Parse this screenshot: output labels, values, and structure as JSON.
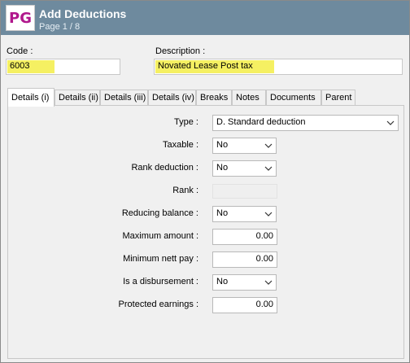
{
  "header": {
    "logo": "PG",
    "title": "Add Deductions",
    "page": "Page 1 / 8"
  },
  "code": {
    "label": "Code :",
    "value": "6003"
  },
  "description": {
    "label": "Description :",
    "value": "Novated Lease Post tax"
  },
  "tabs": [
    {
      "label": "Details (i)"
    },
    {
      "label": "Details (ii)"
    },
    {
      "label": "Details (iii)"
    },
    {
      "label": "Details (iv)"
    },
    {
      "label": "Breaks"
    },
    {
      "label": "Notes"
    },
    {
      "label": "Documents"
    },
    {
      "label": "Parent"
    }
  ],
  "details": {
    "type": {
      "label": "Type :",
      "value": "D. Standard deduction"
    },
    "taxable": {
      "label": "Taxable :",
      "value": "No"
    },
    "rank_deduction": {
      "label": "Rank deduction :",
      "value": "No"
    },
    "rank": {
      "label": "Rank :"
    },
    "reducing_balance": {
      "label": "Reducing balance :",
      "value": "No"
    },
    "maximum_amount": {
      "label": "Maximum amount :",
      "value": "0.00"
    },
    "minimum_nett_pay": {
      "label": "Minimum nett pay :",
      "value": "0.00"
    },
    "is_disbursement": {
      "label": "Is a disbursement :",
      "value": "No"
    },
    "protected_earnings": {
      "label": "Protected earnings :",
      "value": "0.00"
    }
  },
  "icons": {
    "dropdown": "chevron-down-icon"
  },
  "colors": {
    "titlebar": "#6e8a9e",
    "logo_text": "#b0178c",
    "highlight": "#f5f062"
  }
}
